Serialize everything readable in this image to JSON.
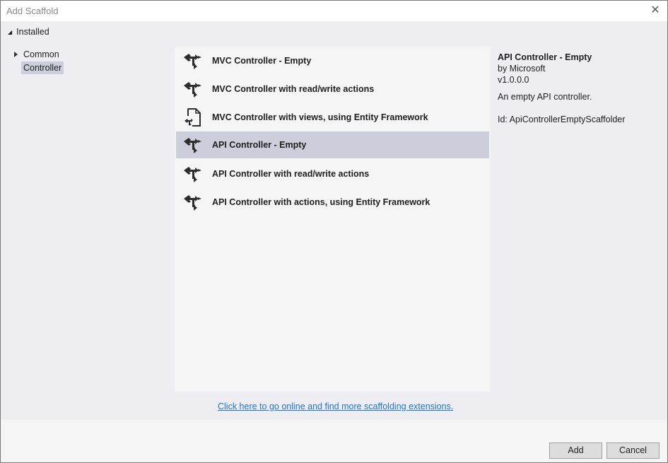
{
  "window": {
    "title": "Add Scaffold",
    "close_icon": "close-icon"
  },
  "tree": {
    "root_label": "Installed",
    "items": [
      {
        "label": "Common",
        "expandable": true,
        "selected": false
      },
      {
        "label": "Controller",
        "expandable": false,
        "selected": true
      }
    ]
  },
  "scaffolds": [
    {
      "label": "MVC Controller - Empty",
      "icon": "controller-icon",
      "selected": false
    },
    {
      "label": "MVC Controller with read/write actions",
      "icon": "controller-icon",
      "selected": false
    },
    {
      "label": "MVC Controller with views, using Entity Framework",
      "icon": "controller-views-icon",
      "selected": false
    },
    {
      "label": "API Controller - Empty",
      "icon": "controller-icon",
      "selected": true
    },
    {
      "label": "API Controller with read/write actions",
      "icon": "controller-icon",
      "selected": false
    },
    {
      "label": "API Controller with actions, using Entity Framework",
      "icon": "controller-icon",
      "selected": false
    }
  ],
  "details": {
    "name": "API Controller - Empty",
    "author": "by Microsoft",
    "version": "v1.0.0.0",
    "description": "An empty API controller.",
    "id": "Id: ApiControllerEmptyScaffolder"
  },
  "online_link": "Click here to go online and find more scaffolding extensions.",
  "buttons": {
    "add": "Add",
    "cancel": "Cancel"
  }
}
